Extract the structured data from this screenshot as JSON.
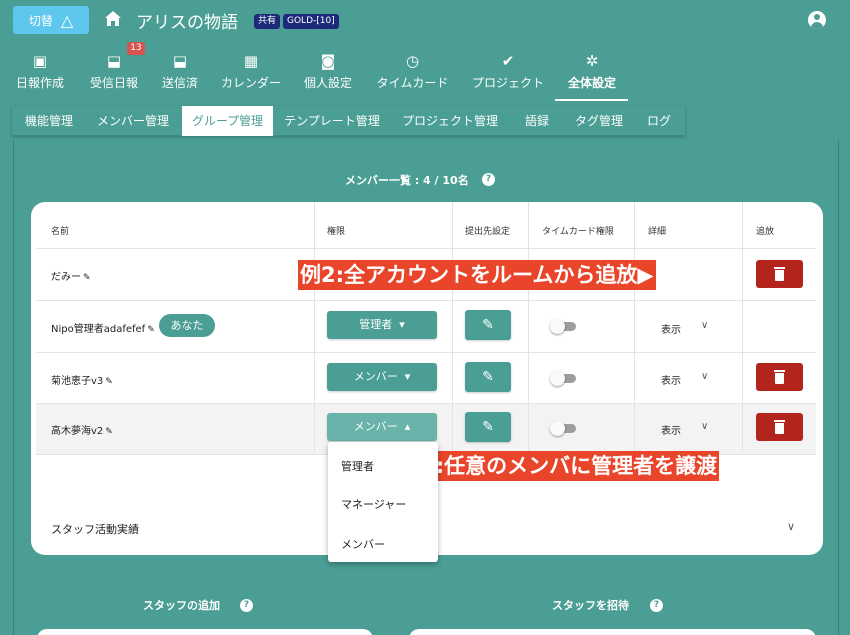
{
  "header": {
    "switch_label": "切替",
    "switch_icon": "triangle-icon",
    "home_icon": "home-icon",
    "title": "アリスの物語",
    "badge_shared": "共有",
    "badge_plan": "GOLD-[10]",
    "account_icon": "account-circle-icon"
  },
  "nav": {
    "tabs": [
      {
        "label": "日報作成",
        "icon": "file-plus-icon",
        "glyph": "▣"
      },
      {
        "label": "受信日報",
        "icon": "inbox-icon",
        "glyph": "⬓",
        "count": "13"
      },
      {
        "label": "送信済",
        "icon": "outbox-icon",
        "glyph": "⬓"
      },
      {
        "label": "カレンダー",
        "icon": "calendar-icon",
        "glyph": "▦"
      },
      {
        "label": "個人設定",
        "icon": "person-card-icon",
        "glyph": "◙"
      },
      {
        "label": "タイムカード",
        "icon": "timer-icon",
        "glyph": "◷"
      },
      {
        "label": "プロジェクト",
        "icon": "check-double-icon",
        "glyph": "✔"
      },
      {
        "label": "全体設定",
        "icon": "gear-icon",
        "glyph": "✲"
      }
    ],
    "active_index": 7
  },
  "subnav": {
    "tabs": [
      "機能管理",
      "メンバー管理",
      "グループ管理",
      "テンプレート管理",
      "プロジェクト管理",
      "語録",
      "タグ管理",
      "ログ"
    ],
    "active_index": 2
  },
  "members": {
    "count_label": "メンバー一覧 : 4 / 10名",
    "columns": [
      "名前",
      "権限",
      "提出先設定",
      "タイムカード権限",
      "詳細",
      "追放"
    ],
    "rows": [
      {
        "name": "だみー",
        "role": "",
        "show": "",
        "deletable": true
      },
      {
        "name": "Nipo管理者adafefef",
        "you": "あなた",
        "role": "管理者",
        "show": "表示",
        "deletable": false
      },
      {
        "name": "菊池恵子v3",
        "role": "メンバー",
        "show": "表示",
        "deletable": true
      },
      {
        "name": "高木夢海v2",
        "role": "メンバー",
        "show": "表示",
        "deletable": true
      }
    ],
    "staff_activity": "スタッフ活動実績"
  },
  "role_dropdown": {
    "options": [
      "管理者",
      "マネージャー",
      "メンバー"
    ],
    "selected": "メンバー"
  },
  "callouts": {
    "example2": "例2:全アカウントをルームから追放▶",
    "example1": "◀例1:任意のメンバに管理者を譲渡"
  },
  "bottom": {
    "add_staff": "スタッフの追加",
    "invite_staff": "スタッフを招待"
  },
  "colors": {
    "teal": "#4a9e94",
    "switch_blue": "#5ec7ee",
    "delete_red": "#b3251c",
    "callout_orange": "#e8452a",
    "badge_navy": "#1d2a7a"
  }
}
